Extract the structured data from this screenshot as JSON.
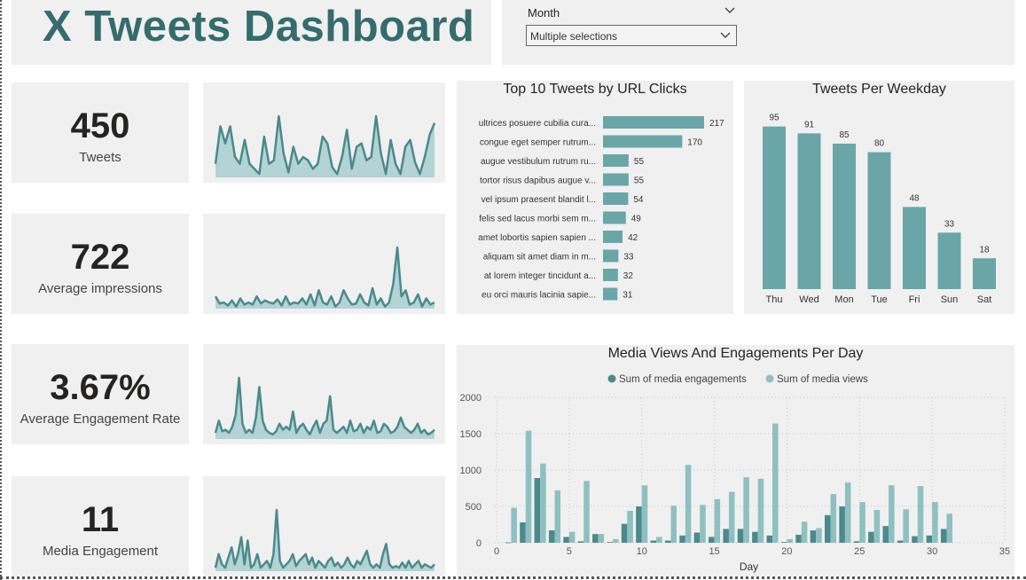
{
  "dashboard": {
    "title": "X Tweets Dashboard"
  },
  "filter": {
    "label": "Month",
    "value": "Multiple selections",
    "icon": "chevron-down-icon"
  },
  "colors": {
    "primary": "#6aa6a8",
    "dark": "#4b8a8c",
    "light": "#8fc0c1",
    "title": "#356c6e",
    "panel": "#f0f0f0"
  },
  "kpis": [
    {
      "value": "450",
      "label": "Tweets"
    },
    {
      "value": "722",
      "label": "Average impressions"
    },
    {
      "value": "3.67%",
      "label": "Average Engagement Rate"
    },
    {
      "value": "11",
      "label": "Media Engagement"
    }
  ],
  "chart_data": [
    {
      "type": "area",
      "title": "",
      "values": [
        8,
        30,
        20,
        30,
        12,
        8,
        22,
        8,
        5,
        2,
        24,
        8,
        10,
        36,
        14,
        3,
        18,
        8,
        12,
        10,
        5,
        8,
        24,
        20,
        6,
        2,
        12,
        28,
        5,
        18,
        20,
        10,
        12,
        36,
        14,
        2,
        22,
        8,
        2,
        18,
        22,
        9,
        2,
        12,
        25,
        32
      ]
    },
    {
      "type": "area",
      "title": "",
      "values": [
        12,
        5,
        6,
        3,
        8,
        2,
        10,
        4,
        6,
        4,
        12,
        5,
        8,
        6,
        5,
        9,
        3,
        12,
        4,
        6,
        5,
        10,
        4,
        14,
        3,
        18,
        6,
        4,
        12,
        2,
        6,
        18,
        10,
        4,
        5,
        14,
        6,
        3,
        20,
        4,
        10,
        2,
        6,
        24,
        60,
        12,
        18,
        4,
        6,
        14,
        2,
        10,
        4,
        6
      ]
    },
    {
      "type": "area",
      "title": "",
      "values": [
        4,
        12,
        5,
        6,
        4,
        8,
        16,
        40,
        10,
        4,
        6,
        4,
        14,
        34,
        12,
        6,
        4,
        3,
        5,
        10,
        6,
        8,
        6,
        18,
        4,
        8,
        10,
        6,
        3,
        8,
        12,
        4,
        10,
        12,
        28,
        6,
        4,
        6,
        8,
        4,
        12,
        5,
        6,
        10,
        4,
        8,
        6,
        12,
        4,
        5,
        10,
        8,
        4,
        5,
        8,
        14,
        8,
        6,
        4,
        6,
        10,
        4,
        6,
        3,
        4,
        6
      ]
    },
    {
      "type": "area",
      "title": "",
      "values": [
        2,
        10,
        4,
        2,
        8,
        14,
        4,
        10,
        20,
        4,
        18,
        2,
        4,
        10,
        2,
        4,
        6,
        2,
        10,
        36,
        6,
        2,
        4,
        6,
        10,
        3,
        6,
        8,
        10,
        4,
        8,
        2,
        6,
        4,
        2,
        6,
        8,
        3,
        5,
        2,
        4,
        8,
        4,
        2,
        6,
        4,
        8,
        12,
        4,
        2,
        4,
        2,
        10,
        16,
        4,
        2,
        3,
        2,
        5,
        2,
        6,
        2,
        4,
        6,
        2,
        4,
        3,
        2,
        4
      ]
    },
    {
      "type": "bar",
      "orientation": "horizontal",
      "title": "Top 10 Tweets by URL Clicks",
      "categories": [
        "ultrices posuere cubilia cura...",
        "congue eget semper rutrum...",
        "augue vestibulum rutrum ru...",
        "tortor risus dapibus augue v...",
        "vel ipsum praesent blandit l...",
        "felis sed lacus morbi sem m...",
        "amet lobortis sapien sapien ...",
        "aliquam sit amet diam in m...",
        "at lorem integer tincidunt a...",
        "eu orci mauris lacinia sapie..."
      ],
      "values": [
        217,
        170,
        55,
        55,
        54,
        49,
        42,
        33,
        32,
        31
      ]
    },
    {
      "type": "bar",
      "title": "Tweets Per Weekday",
      "categories": [
        "Thu",
        "Wed",
        "Mon",
        "Tue",
        "Fri",
        "Sun",
        "Sat"
      ],
      "values": [
        95,
        91,
        85,
        80,
        48,
        33,
        18
      ],
      "ylim": [
        0,
        100
      ]
    },
    {
      "type": "bar",
      "title": "Media Views And Engagements Per Day",
      "xlabel": "Day",
      "ylabel": "",
      "legend_position": "top",
      "ylim": [
        0,
        2000
      ],
      "xlim": [
        0,
        35
      ],
      "yticks": [
        0,
        500,
        1000,
        1500,
        2000
      ],
      "xticks": [
        0,
        5,
        10,
        15,
        20,
        25,
        30,
        35
      ],
      "grid": true,
      "x": [
        1,
        2,
        3,
        4,
        5,
        6,
        7,
        8,
        9,
        10,
        11,
        12,
        13,
        14,
        15,
        16,
        17,
        18,
        19,
        20,
        21,
        22,
        23,
        24,
        25,
        26,
        27,
        28,
        29,
        30,
        31
      ],
      "series": [
        {
          "name": "Sum of media engagements",
          "values": [
            5,
            280,
            890,
            170,
            80,
            20,
            120,
            10,
            260,
            500,
            30,
            30,
            100,
            140,
            80,
            190,
            190,
            150,
            100,
            10,
            110,
            170,
            380,
            500,
            20,
            150,
            230,
            30,
            90,
            100,
            190
          ]
        },
        {
          "name": "Sum of media views",
          "values": [
            480,
            1540,
            1090,
            720,
            150,
            850,
            120,
            50,
            440,
            790,
            80,
            510,
            1070,
            520,
            600,
            700,
            900,
            880,
            1640,
            50,
            290,
            200,
            670,
            830,
            560,
            450,
            790,
            460,
            780,
            560,
            400
          ]
        }
      ]
    }
  ]
}
